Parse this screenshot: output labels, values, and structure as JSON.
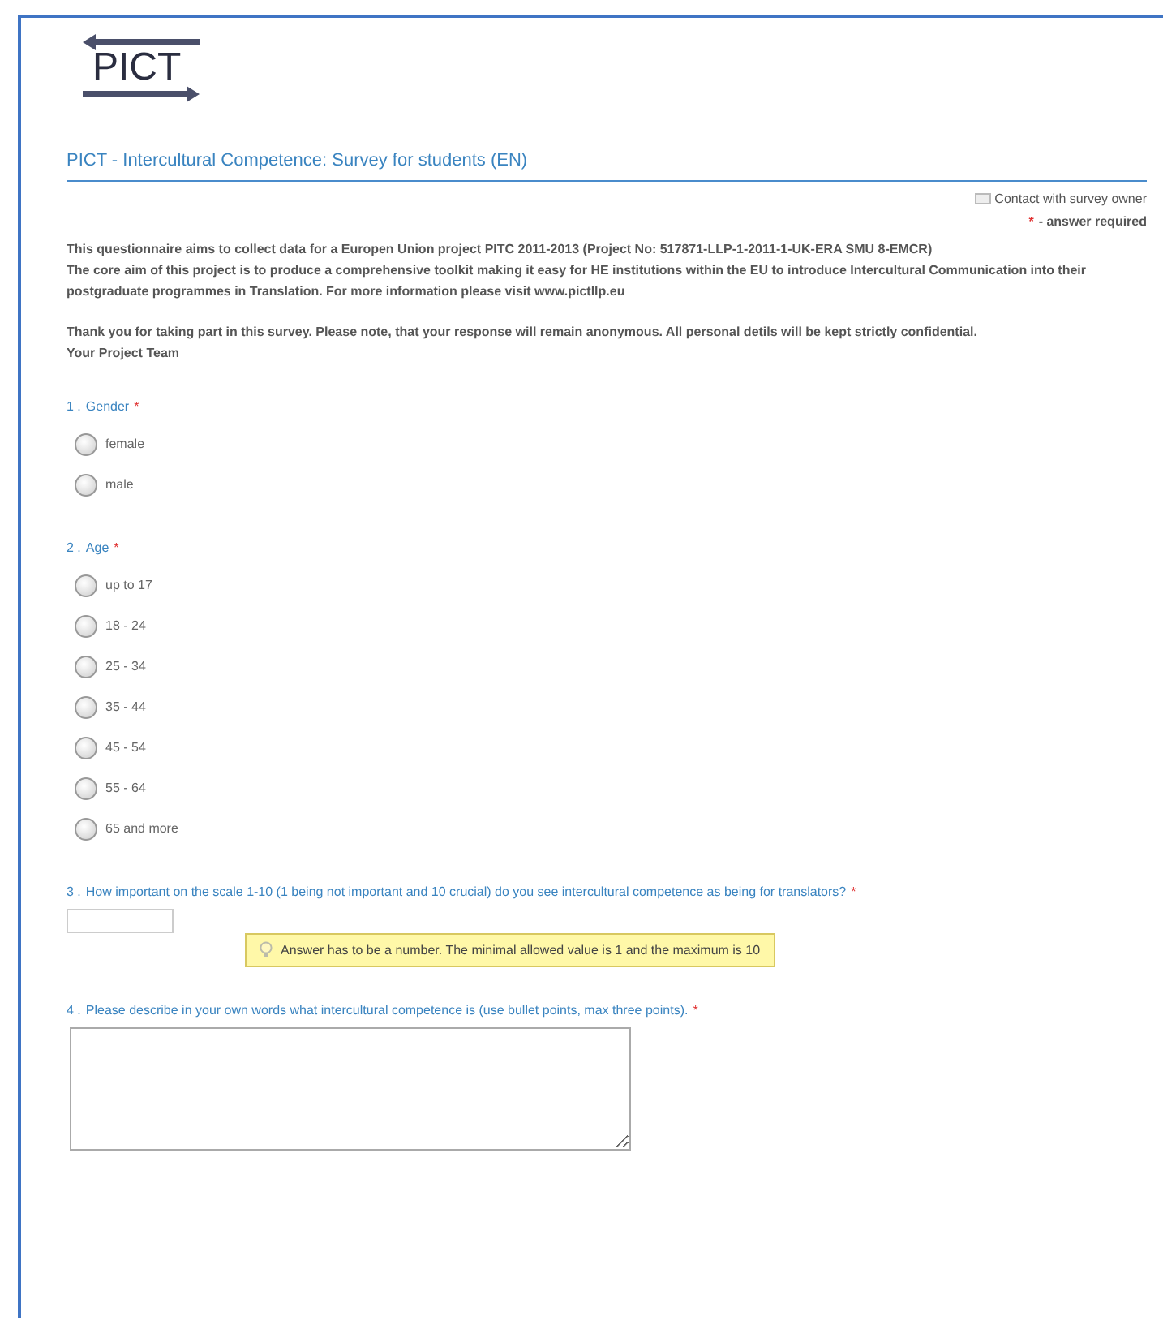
{
  "logo": {
    "text": "PICT"
  },
  "survey_title": "PICT - Intercultural Competence: Survey for students (EN)",
  "contact_link": "Contact with survey owner",
  "required_legend": {
    "mark": "*",
    "text": "- answer required"
  },
  "intro": [
    [
      "This questionnaire aims to collect data for a Europen Union project PITC 2011-2013 (Project No: 517871-LLP-1-2011-1-UK-ERA SMU 8-EMCR)",
      "The core aim of this project is to produce a comprehensive toolkit making it easy for HE institutions within the EU to introduce Intercultural Communication into their postgraduate programmes in Translation. For more information please visit www.pictllp.eu"
    ],
    [
      "Thank you for taking part in this survey. Please note, that your response will remain anonymous. All personal detils will be kept strictly confidential.",
      "Your Project Team"
    ]
  ],
  "questions": [
    {
      "number": "1 .",
      "text": "Gender",
      "required_mark": "*",
      "kind": "radio",
      "options": [
        {
          "label": "female",
          "selected": false
        },
        {
          "label": "male",
          "selected": false
        }
      ]
    },
    {
      "number": "2 .",
      "text": "Age",
      "required_mark": "*",
      "kind": "radio",
      "options": [
        {
          "label": "up to 17",
          "selected": false
        },
        {
          "label": "18 - 24",
          "selected": false
        },
        {
          "label": "25 - 34",
          "selected": false
        },
        {
          "label": "35 - 44",
          "selected": false
        },
        {
          "label": "45 - 54",
          "selected": false
        },
        {
          "label": "55 - 64",
          "selected": false
        },
        {
          "label": "65 and more",
          "selected": false
        }
      ]
    },
    {
      "number": "3 .",
      "text": "How important on the scale 1-10 (1 being not important and 10 crucial) do you see intercultural competence as being for translators?",
      "required_mark": "*",
      "kind": "number",
      "hint": "Answer has to be a number. The minimal allowed value is 1 and the maximum is 10"
    },
    {
      "number": "4 .",
      "text": "Please describe in your own words what intercultural competence is (use bullet points, max three points).",
      "required_mark": "*",
      "kind": "textarea"
    }
  ]
}
